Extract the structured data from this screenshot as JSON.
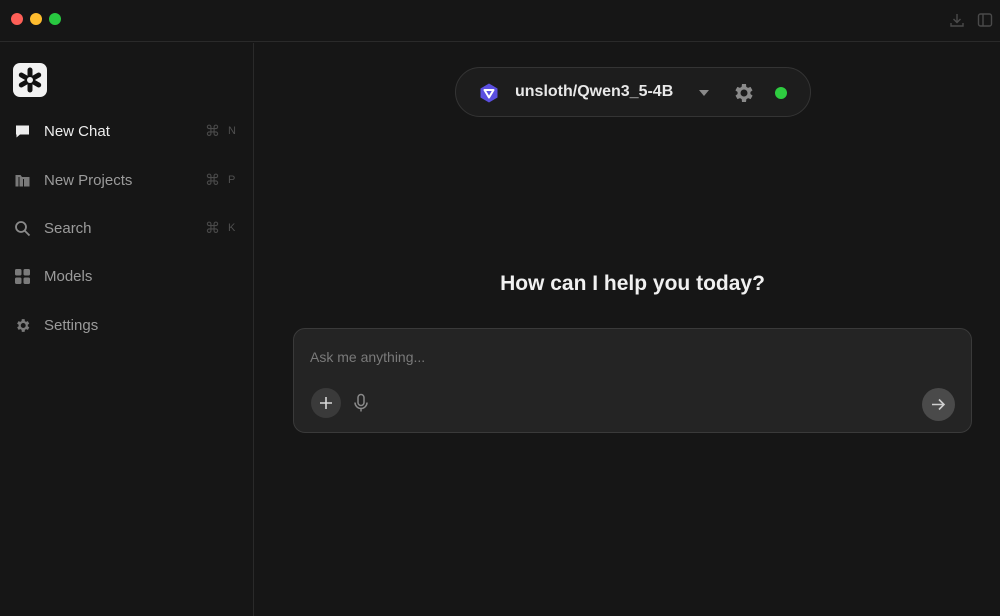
{
  "titlebar": {
    "buttons": [
      "close",
      "minimize",
      "zoom"
    ],
    "icons": [
      "download-icon",
      "sidebar-panel-icon"
    ]
  },
  "sidebar": {
    "logo": "asterisk-logo",
    "items": [
      {
        "label": "New Chat",
        "icon": "chat-bubble-icon",
        "shortcut_symbol": "⌘",
        "shortcut_key": "N",
        "active": true
      },
      {
        "label": "New Projects",
        "icon": "folder-icon",
        "shortcut_symbol": "⌘",
        "shortcut_key": "P",
        "active": false
      },
      {
        "label": "Search",
        "icon": "search-icon",
        "shortcut_symbol": "⌘",
        "shortcut_key": "K",
        "active": false
      },
      {
        "label": "Models",
        "icon": "grid-icon",
        "active": false
      },
      {
        "label": "Settings",
        "icon": "gear-icon",
        "active": false
      }
    ]
  },
  "model_selector": {
    "name": "unsloth/Qwen3_5-4B",
    "status": "online",
    "status_color": "#2ecc40"
  },
  "main": {
    "heading": "How can I help you today?"
  },
  "composer": {
    "placeholder": "Ask me anything..."
  },
  "colors": {
    "background": "#161616",
    "composer": "#242424",
    "accent_green": "#2ecc40"
  }
}
